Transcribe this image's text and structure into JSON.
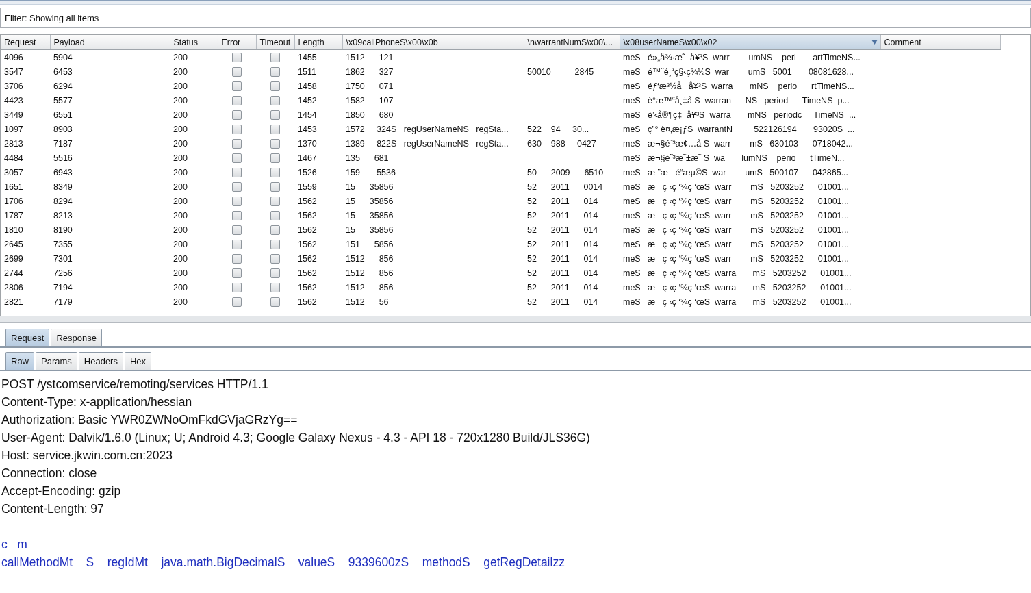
{
  "filter": {
    "label": "Filter: Showing all items"
  },
  "table": {
    "columns": [
      {
        "label": "Request",
        "sorted": false
      },
      {
        "label": "Payload",
        "sorted": false
      },
      {
        "label": "Status",
        "sorted": false
      },
      {
        "label": "Error",
        "sorted": false
      },
      {
        "label": "Timeout",
        "sorted": false
      },
      {
        "label": "Length",
        "sorted": false
      },
      {
        "label": "\\x09callPhoneS\\x00\\x0b",
        "sorted": false
      },
      {
        "label": "\\nwarrantNumS\\x00\\...",
        "sorted": false
      },
      {
        "label": "\\x08userNameS\\x00\\x02",
        "sorted": true
      },
      {
        "label": "Comment",
        "sorted": false
      }
    ],
    "rows": [
      {
        "request": "4096",
        "payload": "5904",
        "status": "200",
        "error": false,
        "timeout": false,
        "length": "1455",
        "column_7": "1512      121",
        "column_8": "",
        "column_9": "meS   é»„å¾·æ˜  å¥³S  warr        umNS    peri       artTimeNS..."
      },
      {
        "request": "3547",
        "payload": "6453",
        "status": "200",
        "error": false,
        "timeout": false,
        "length": "1511",
        "column_7": "1862      327",
        "column_8": "50010          2845",
        "column_9": "meS   é™ˆé¸“ç§‹ç¾½S  war        umS   5001       08081628..."
      },
      {
        "request": "3706",
        "payload": "6294",
        "status": "200",
        "error": false,
        "timeout": false,
        "length": "1458",
        "column_7": "1750      071",
        "column_8": "",
        "column_9": "meS   éƒ‘æ³½å   å¥³S  warra       mNS    perio      rtTimeNS..."
      },
      {
        "request": "4423",
        "payload": "5577",
        "status": "200",
        "error": false,
        "timeout": false,
        "length": "1452",
        "column_7": "1582      107",
        "column_8": "",
        "column_9": "meS   è°­æ™“å¸‡å­ S  warran      NS   period      TimeNS  p..."
      },
      {
        "request": "3449",
        "payload": "6551",
        "status": "200",
        "error": false,
        "timeout": false,
        "length": "1454",
        "column_7": "1850      680",
        "column_8": "",
        "column_9": "meS   è’‹å®¶ç‡  å¥³S  warra       mNS   periodc     TimeNS  ..."
      },
      {
        "request": "1097",
        "payload": "8903",
        "status": "200",
        "error": false,
        "timeout": false,
        "length": "1453",
        "column_7": "1572     324S   regUserNameNS   regSta...",
        "column_8": "522    94     30...",
        "column_9": "meS   ç”° è¤‚æ¡ƒS  warrantN         522126194       93020S  ..."
      },
      {
        "request": "2813",
        "payload": "7187",
        "status": "200",
        "error": false,
        "timeout": false,
        "length": "1370",
        "column_7": "1389     822S   regUserNameNS   regSta...",
        "column_8": "630    988     0427",
        "column_9": "meS   æ¬§é˜³æ¢…å­ S  warr        mS   630103      0718042..."
      },
      {
        "request": "4484",
        "payload": "5516",
        "status": "200",
        "error": false,
        "timeout": false,
        "length": "1467",
        "column_7": "135      681",
        "column_8": "",
        "column_9": "meS   æ¬§é˜³æ˜±æ˜ S  wa       lumNS    perio      tTimeN..."
      },
      {
        "request": "3057",
        "payload": "6943",
        "status": "200",
        "error": false,
        "timeout": false,
        "length": "1526",
        "column_7": "159       5536",
        "column_8": "50      2009      6510",
        "column_9": "meS   æ ¨æ   é“­æµ©S  war        umS   500107      042865..."
      },
      {
        "request": "1651",
        "payload": "8349",
        "status": "200",
        "error": false,
        "timeout": false,
        "length": "1559",
        "column_7": "15      35856",
        "column_8": "52      2011      0014",
        "column_9": "meS   æ   ç ‹ç ‘¾ç ‘œS  warr        mS   5203252      01001..."
      },
      {
        "request": "1706",
        "payload": "8294",
        "status": "200",
        "error": false,
        "timeout": false,
        "length": "1562",
        "column_7": "15      35856",
        "column_8": "52      2011      014",
        "column_9": "meS   æ   ç ‹ç ‘¾ç ‘œS  warr        mS   5203252      01001..."
      },
      {
        "request": "1787",
        "payload": "8213",
        "status": "200",
        "error": false,
        "timeout": false,
        "length": "1562",
        "column_7": "15      35856",
        "column_8": "52      2011      014",
        "column_9": "meS   æ   ç ‹ç ‘¾ç ‘œS  warr        mS   5203252      01001..."
      },
      {
        "request": "1810",
        "payload": "8190",
        "status": "200",
        "error": false,
        "timeout": false,
        "length": "1562",
        "column_7": "15      35856",
        "column_8": "52      2011      014",
        "column_9": "meS   æ   ç ‹ç ‘¾ç ‘œS  warr        mS   5203252      01001..."
      },
      {
        "request": "2645",
        "payload": "7355",
        "status": "200",
        "error": false,
        "timeout": false,
        "length": "1562",
        "column_7": "151      5856",
        "column_8": "52      2011      014",
        "column_9": "meS   æ   ç ‹ç ‘¾ç ‘œS  warr        mS   5203252      01001..."
      },
      {
        "request": "2699",
        "payload": "7301",
        "status": "200",
        "error": false,
        "timeout": false,
        "length": "1562",
        "column_7": "1512      856",
        "column_8": "52      2011      014",
        "column_9": "meS   æ   ç ‹ç ‘¾ç ‘œS  warr        mS   5203252      01001..."
      },
      {
        "request": "2744",
        "payload": "7256",
        "status": "200",
        "error": false,
        "timeout": false,
        "length": "1562",
        "column_7": "1512      856",
        "column_8": "52      2011      014",
        "column_9": "meS   æ   ç ‹ç ‘¾ç ‘œS  warra       mS   5203252      01001..."
      },
      {
        "request": "2806",
        "payload": "7194",
        "status": "200",
        "error": false,
        "timeout": false,
        "length": "1562",
        "column_7": "1512      856",
        "column_8": "52      2011      014",
        "column_9": "meS   æ   ç ‹ç ‘¾ç ‘œS  warra       mS   5203252      01001..."
      },
      {
        "request": "2821",
        "payload": "7179",
        "status": "200",
        "error": false,
        "timeout": false,
        "length": "1562",
        "column_7": "1512      56",
        "column_8": "52      2011      014",
        "column_9": "meS   æ   ç ‹ç ‘¾ç ‘œS  warra       mS   5203252      01001..."
      }
    ]
  },
  "message_tabs": [
    {
      "label": "Request",
      "selected": true
    },
    {
      "label": "Response",
      "selected": false
    }
  ],
  "view_tabs": [
    {
      "label": "Raw",
      "selected": true
    },
    {
      "label": "Params",
      "selected": false
    },
    {
      "label": "Headers",
      "selected": false
    },
    {
      "label": "Hex",
      "selected": false
    }
  ],
  "raw_lines": [
    {
      "kind": "header",
      "text": "POST /ystcomservice/remoting/services HTTP/1.1"
    },
    {
      "kind": "header",
      "text": "Content-Type: x-application/hessian"
    },
    {
      "kind": "header",
      "text": "Authorization: Basic YWR0ZWNoOmFkdGVjaGRzYg=="
    },
    {
      "kind": "header",
      "text": "User-Agent: Dalvik/1.6.0 (Linux; U; Android 4.3; Google Galaxy Nexus - 4.3 - API 18 - 720x1280 Build/JLS36G)"
    },
    {
      "kind": "header",
      "text": "Host: service.jkwin.com.cn:2023"
    },
    {
      "kind": "header",
      "text": "Connection: close"
    },
    {
      "kind": "header",
      "text": "Accept-Encoding: gzip"
    },
    {
      "kind": "header",
      "text": "Content-Length: 97"
    },
    {
      "kind": "blank"
    },
    {
      "kind": "body",
      "text": "c   m"
    },
    {
      "kind": "body",
      "text": "callMethodMt    S    regIdMt    java.math.BigDecimalS    valueS    9339600zS    methodS    getRegDetailzz"
    }
  ]
}
